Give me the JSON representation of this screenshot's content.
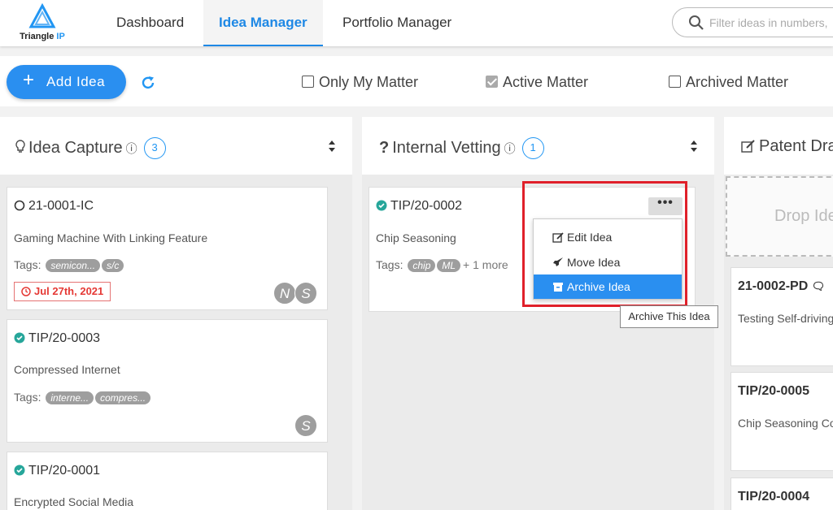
{
  "brand": {
    "name": "Triangle",
    "suffix": "IP"
  },
  "nav": {
    "tabs": [
      {
        "label": "Dashboard"
      },
      {
        "label": "Idea Manager"
      },
      {
        "label": "Portfolio Manager"
      }
    ],
    "search_placeholder": "Filter ideas in numbers,"
  },
  "toolbar": {
    "add_label": "Add Idea",
    "filters": [
      {
        "label": "Only My Matter",
        "checked": false
      },
      {
        "label": "Active Matter",
        "checked": true
      },
      {
        "label": "Archived Matter",
        "checked": false
      }
    ]
  },
  "columns": [
    {
      "title": "Idea Capture",
      "count": "3",
      "icon": "lightbulb-icon"
    },
    {
      "title": "Internal Vetting",
      "count": "1",
      "icon": "question-icon"
    },
    {
      "title": "Patent Dra",
      "icon": "edit-icon"
    }
  ],
  "cards": {
    "c1": {
      "id": "21-0001-IC",
      "title": "Gaming Machine With Linking Feature",
      "tags_label": "Tags:",
      "tags": [
        "semicon...",
        "s/c"
      ],
      "date": "Jul 27th, 2021",
      "avatars": [
        "N",
        "S"
      ]
    },
    "c2": {
      "id": "TIP/20-0003",
      "title": "Compressed Internet",
      "tags_label": "Tags:",
      "tags": [
        "interne...",
        "compres..."
      ],
      "avatars": [
        "S"
      ]
    },
    "c3": {
      "id": "TIP/20-0001",
      "title": "Encrypted Social Media"
    },
    "c4": {
      "id": "TIP/20-0002",
      "title": "Chip Seasoning",
      "tags_label": "Tags:",
      "tags": [
        "chip",
        "ML"
      ],
      "more": "+ 1 more"
    },
    "c5": {
      "id": "21-0002-PD",
      "title": "Testing Self-driving"
    },
    "c6": {
      "id": "TIP/20-0005",
      "title": "Chip Seasoning Co"
    },
    "c7": {
      "id": "TIP/20-0004"
    }
  },
  "dropzone_label": "Drop Ide",
  "menu": {
    "dots": "•••",
    "items": [
      {
        "label": "Edit Idea",
        "icon": "edit-icon"
      },
      {
        "label": "Move Idea",
        "icon": "rocket-icon"
      },
      {
        "label": "Archive Idea",
        "icon": "archive-icon"
      }
    ]
  },
  "tooltip": "Archive This Idea",
  "colors": {
    "accent": "#2a8ff0",
    "success": "#26a69a",
    "danger": "#e53935",
    "highlight": "#e0202a"
  }
}
